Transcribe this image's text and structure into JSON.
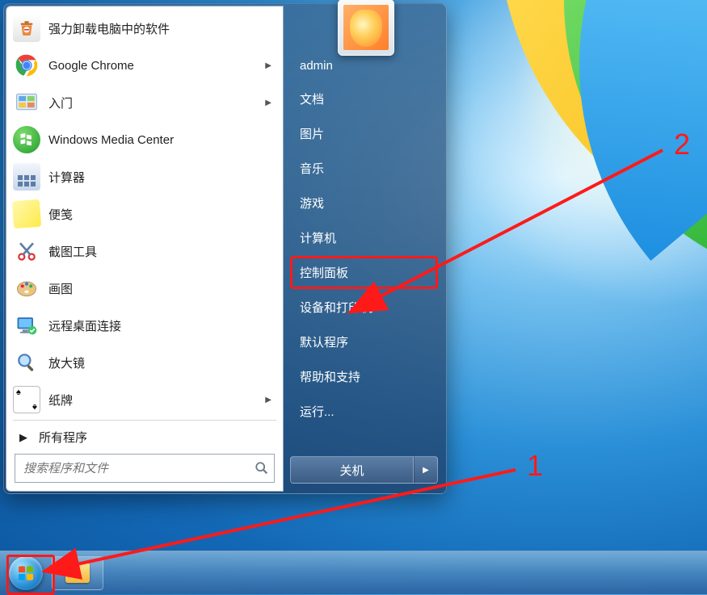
{
  "left_programs": [
    {
      "label": "强力卸载电脑中的软件",
      "icon": "uninstall-icon",
      "has_submenu": false
    },
    {
      "label": "Google Chrome",
      "icon": "chrome-icon",
      "has_submenu": true
    },
    {
      "label": "入门",
      "icon": "getting-started-icon",
      "has_submenu": true
    },
    {
      "label": "Windows Media Center",
      "icon": "wmc-icon",
      "has_submenu": false
    },
    {
      "label": "计算器",
      "icon": "calculator-icon",
      "has_submenu": false
    },
    {
      "label": "便笺",
      "icon": "sticky-notes-icon",
      "has_submenu": false
    },
    {
      "label": "截图工具",
      "icon": "snipping-tool-icon",
      "has_submenu": false
    },
    {
      "label": "画图",
      "icon": "paint-icon",
      "has_submenu": false
    },
    {
      "label": "远程桌面连接",
      "icon": "remote-desktop-icon",
      "has_submenu": false
    },
    {
      "label": "放大镜",
      "icon": "magnifier-icon",
      "has_submenu": false
    },
    {
      "label": "纸牌",
      "icon": "solitaire-icon",
      "has_submenu": true
    }
  ],
  "all_programs_label": "所有程序",
  "search_placeholder": "搜索程序和文件",
  "right_items": [
    {
      "label": "admin",
      "key": "user"
    },
    {
      "label": "文档",
      "key": "documents"
    },
    {
      "label": "图片",
      "key": "pictures"
    },
    {
      "label": "音乐",
      "key": "music"
    },
    {
      "label": "游戏",
      "key": "games"
    },
    {
      "label": "计算机",
      "key": "computer"
    },
    {
      "label": "控制面板",
      "key": "control-panel",
      "highlighted": true
    },
    {
      "label": "设备和打印机",
      "key": "devices-printers"
    },
    {
      "label": "默认程序",
      "key": "default-programs"
    },
    {
      "label": "帮助和支持",
      "key": "help-support"
    },
    {
      "label": "运行...",
      "key": "run"
    }
  ],
  "shutdown_label": "关机",
  "annotations": {
    "num1": "1",
    "num2": "2"
  },
  "colors": {
    "annotation": "#ff1a1a"
  }
}
